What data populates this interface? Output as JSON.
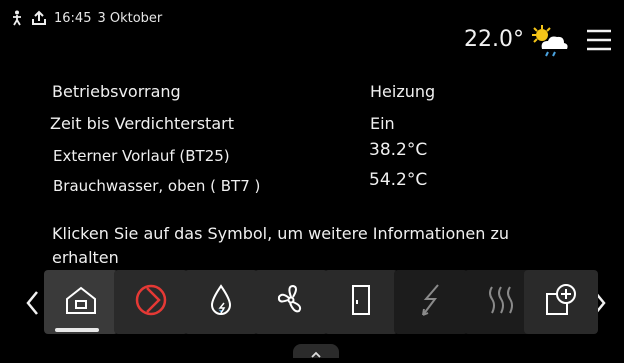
{
  "status": {
    "time": "16:45",
    "date": "3 Oktober"
  },
  "weather": {
    "temperature": "22.0°",
    "icon": "sun-cloud-rain-icon"
  },
  "info_rows": [
    {
      "label": "Betriebsvorrang",
      "value": "Heizung"
    },
    {
      "label": "Zeit bis Verdichterstart",
      "value": "Ein"
    },
    {
      "label": "Externer Vorlauf   (BT25)",
      "value": "38.2°C"
    },
    {
      "label": "Brauchwasser, oben (   BT7 )",
      "value": "54.2°C"
    }
  ],
  "hint": "Klicken Sie auf das Symbol, um weitere Informationen zu erhalten",
  "tiles": [
    {
      "icon": "home-icon",
      "active": true
    },
    {
      "icon": "compressor-icon",
      "color": "#e53935"
    },
    {
      "icon": "hot-water-drop-icon"
    },
    {
      "icon": "fan-icon"
    },
    {
      "icon": "door-icon"
    },
    {
      "icon": "lightning-icon",
      "dimmed": true
    },
    {
      "icon": "heat-waves-icon",
      "dimmed": true
    },
    {
      "icon": "add-accessory-icon"
    }
  ]
}
